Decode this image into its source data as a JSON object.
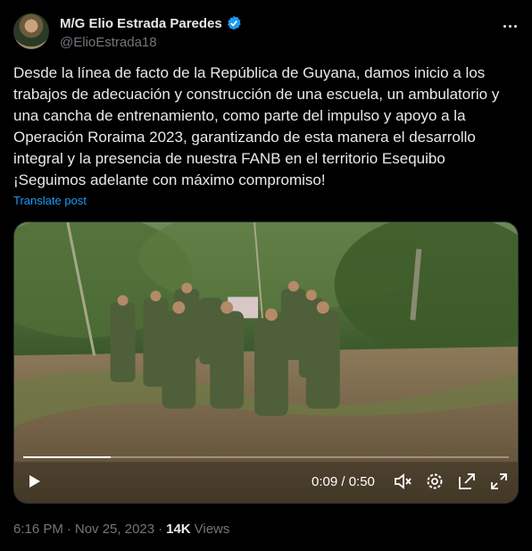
{
  "author": {
    "name": "M/G Elio Estrada Paredes",
    "handle": "@ElioEstrada18",
    "verified_color": "#1d9bf0"
  },
  "tweet": {
    "text": "Desde la línea de facto de la República de Guyana, damos inicio a los\ntrabajos de adecuación y construcción de una escuela, un ambulatorio y\nuna cancha de entrenamiento, como parte del impulso y apoyo a la\nOperación Roraima 2023, garantizando de esta manera el desarrollo\nintegral y la presencia de nuestra FANB en el territorio Esequibo\n¡Seguimos adelante con máximo compromiso!",
    "translate_label": "Translate post"
  },
  "video": {
    "current_time": "0:09",
    "duration": "0:50",
    "time_display": "0:09 / 0:50",
    "progress": 0.18,
    "icons": [
      "play-icon",
      "mute-icon",
      "settings-icon",
      "pip-icon",
      "fullscreen-icon"
    ]
  },
  "meta": {
    "time": "6:16 PM",
    "separator": "·",
    "date": "Nov 25, 2023",
    "views_count": "14K",
    "views_label": "Views"
  },
  "colors": {
    "background": "#000000",
    "text": "#e7e9ea",
    "muted": "#71767b",
    "accent": "#1d9bf0"
  }
}
